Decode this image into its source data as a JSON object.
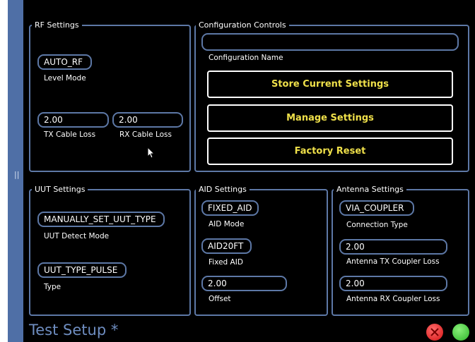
{
  "rf_settings": {
    "title": "RF Settings",
    "level_mode": {
      "value": "AUTO_RF",
      "label": "Level Mode"
    },
    "tx_cable_loss": {
      "value": "2.00",
      "label": "TX Cable Loss"
    },
    "rx_cable_loss": {
      "value": "2.00",
      "label": "RX Cable Loss"
    }
  },
  "config_controls": {
    "title": "Configuration Controls",
    "name": {
      "value": "",
      "label": "Configuration Name"
    },
    "store_label": "Store Current Settings",
    "manage_label": "Manage Settings",
    "reset_label": "Factory Reset"
  },
  "uut_settings": {
    "title": "UUT Settings",
    "detect_mode": {
      "value": "MANUALLY_SET_UUT_TYPE",
      "label": "UUT Detect Mode"
    },
    "type": {
      "value": "UUT_TYPE_PULSE",
      "label": "Type"
    }
  },
  "aid_settings": {
    "title": "AID Settings",
    "mode": {
      "value": "FIXED_AID",
      "label": "AID Mode"
    },
    "fixed": {
      "value": "AID20FT",
      "label": "Fixed AID"
    },
    "offset": {
      "value": "2.00",
      "label": "Offset"
    }
  },
  "antenna_settings": {
    "title": "Antenna Settings",
    "connection": {
      "value": "VIA_COUPLER",
      "label": "Connection Type"
    },
    "tx_loss": {
      "value": "2.00",
      "label": "Antenna TX Coupler Loss"
    },
    "rx_loss": {
      "value": "2.00",
      "label": "Antenna RX Coupler Loss"
    }
  },
  "footer": {
    "title": "Test Setup *",
    "close_icon": "close-icon",
    "ok_icon": "ok-icon"
  },
  "sidebar": {
    "grip": "||"
  },
  "colors": {
    "border": "#5d78a6",
    "button_text": "#efe04a",
    "title": "#6e8dc0"
  }
}
